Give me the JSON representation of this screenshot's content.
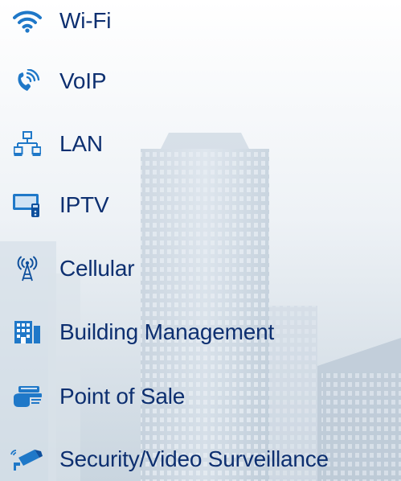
{
  "colors": {
    "text": "#0d2f70",
    "icon": "#1f78c8",
    "icon_dark": "#0e4f9c",
    "background_top": "#ffffff",
    "background_bottom": "#c7d3de"
  },
  "services": [
    {
      "label": "Wi-Fi",
      "icon": "wifi-icon"
    },
    {
      "label": "VoIP",
      "icon": "voip-phone-icon"
    },
    {
      "label": "LAN",
      "icon": "lan-network-icon"
    },
    {
      "label": "IPTV",
      "icon": "iptv-monitor-icon"
    },
    {
      "label": "Cellular",
      "icon": "cellular-antenna-icon"
    },
    {
      "label": "Building Management",
      "icon": "building-icon"
    },
    {
      "label": "Point of Sale",
      "icon": "card-reader-icon"
    },
    {
      "label": "Security/Video Surveillance",
      "icon": "security-camera-icon"
    }
  ]
}
